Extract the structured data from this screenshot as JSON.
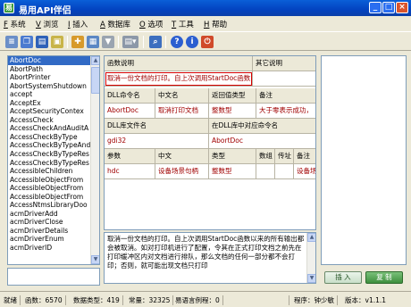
{
  "window": {
    "title": "易用API伴侣",
    "app_icon": "易",
    "minimize": "_",
    "maximize": "□",
    "close": "×"
  },
  "menu": [
    {
      "key": "F",
      "label": "系统"
    },
    {
      "key": "V",
      "label": "浏览"
    },
    {
      "key": "I",
      "label": "插入"
    },
    {
      "key": "A",
      "label": "数据库"
    },
    {
      "key": "O",
      "label": "选项"
    },
    {
      "key": "T",
      "label": "工具"
    },
    {
      "key": "H",
      "label": "帮助"
    }
  ],
  "api_list": {
    "selected": "AbortDoc",
    "items": [
      "AbortDoc",
      "AbortPath",
      "AbortPrinter",
      "AbortSystemShutdown",
      "accept",
      "AcceptEx",
      "AcceptSecurityContex",
      "AccessCheck",
      "AccessCheckAndAuditA",
      "AccessCheckByType",
      "AccessCheckByTypeAnd",
      "AccessCheckByTypeRes",
      "AccessCheckByTypeRes",
      "AccessibleChildren",
      "AccessibleObjectFrom",
      "AccessibleObjectFrom",
      "AccessibleObjectFrom",
      "AccessNtmsLibraryDoo",
      "acmDriverAdd",
      "acmDriverClose",
      "acmDriverDetails",
      "acmDriverEnum",
      "acmDriverID"
    ]
  },
  "detail": {
    "func_desc_header": "函数说明",
    "other_desc_header": "其它说明",
    "func_desc": "取消一份文档的打印。自上次调用StartDoc函数以来的所有输出都会被取消",
    "other_desc": "",
    "dll_cmd_header": "DLL命令名",
    "cn_name_header": "中文名",
    "ret_type_header": "返回值类型",
    "remark_header": "备注",
    "dll_cmd": "AbortDoc",
    "cn_name": "取消打印文档",
    "ret_type": "整数型",
    "remark": "大于零表示成功，",
    "dll_file_header": "DLL库文件名",
    "dll_func_header": "在DLL库中对应命令名",
    "dll_file": "gdi32",
    "dll_func": "AbortDoc",
    "param_header": "参数",
    "param_cn_header": "中文",
    "param_type_header": "类型",
    "array_header": "数组",
    "byref_header": "传址",
    "param_remark_header": "备注",
    "param_name": "hdc",
    "param_cn": "设备场景句柄",
    "param_type": "整数型",
    "param_remark": "设备场景"
  },
  "description": "取消一份文档的打印。自上次调用StartDoc函数以来的所有输出都会被取消。如对打印机进行了配置，令其在正式打印文档之前先在打印缓冲区内对文档进行排队，那么文档的任何一部分都不会打印；否则，就可能出现文档只打印",
  "buttons": {
    "insert": "插  入",
    "copy": "复  制"
  },
  "status": {
    "ready": "就绪",
    "functions": "函数：6570",
    "datatypes": "数据类型：419",
    "constants": "常量：32325",
    "example": "易语言例程：0",
    "author": "程序：钟少敏",
    "version": "版本：v1.1.1"
  },
  "colors": {
    "title_bar": "#0343c0",
    "selection": "#316ac5",
    "value_text": "#a00000",
    "highlight_border": "#d60000"
  }
}
